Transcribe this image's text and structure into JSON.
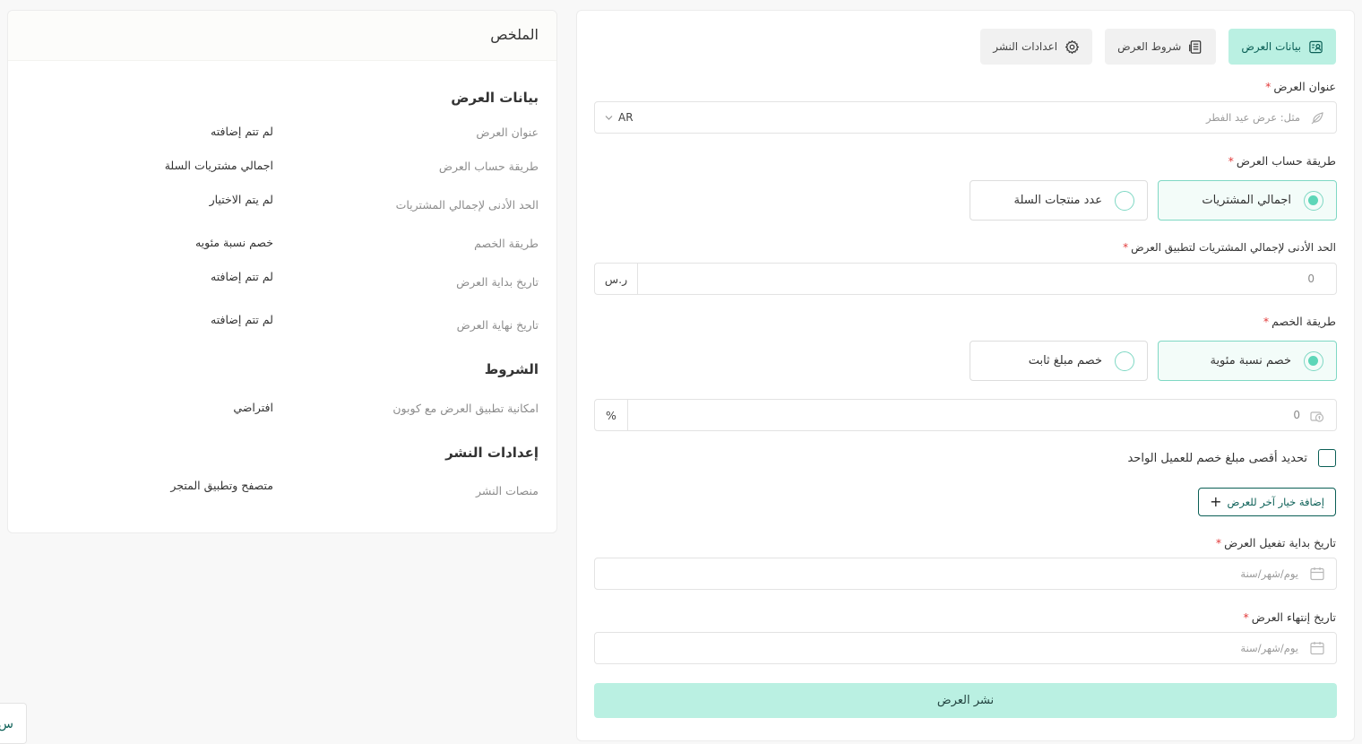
{
  "tabs": {
    "offer_data": "بيانات العرض",
    "offer_terms": "شروط العرض",
    "publish_settings": "اعدادات النشر"
  },
  "form": {
    "title_label": "عنوان العرض",
    "title_placeholder": "مثل: عرض عيد الفطر",
    "language": "AR",
    "calc_method_label": "طريقة حساب العرض",
    "calc_options": [
      "اجمالي المشتريات",
      "عدد منتجات السلة"
    ],
    "calc_selected": "اجمالي المشتريات",
    "min_total_label": "الحد الأدنى لإجمالي المشتريات لتطبيق العرض",
    "min_total_value": "0",
    "currency": "ر.س",
    "discount_method_label": "طريقة الخصم",
    "discount_options": [
      "خصم نسبة مئوية",
      "خصم مبلغ ثابت"
    ],
    "discount_selected": "خصم نسبة مئوية",
    "discount_value": "0",
    "percent_unit": "%",
    "max_discount_checkbox": "تحديد أقصى مبلغ خصم للعميل الواحد",
    "add_option_button": "إضافة خيار آخر للعرض",
    "start_date_label": "تاريخ بداية تفعيل العرض",
    "start_date_placeholder": "يوم/شهر/سنة",
    "end_date_label": "تاريخ إنتهاء العرض",
    "end_date_placeholder": "يوم/شهر/سنة",
    "publish_button": "نشر العرض",
    "required_mark": "*"
  },
  "summary": {
    "title": "الملخص",
    "sections": {
      "offer_data": {
        "title": "بيانات العرض",
        "rows": [
          {
            "key": "عنوان العرض",
            "value": "لم تتم إضافته"
          },
          {
            "key": "طريقة حساب العرض",
            "value": "اجمالي مشتريات السلة"
          },
          {
            "key": "الحد الأدنى لإجمالي المشتريات",
            "value": "لم يتم الاختيار"
          },
          {
            "key": "طريقة الخصم",
            "value": "خصم نسبة مئويه"
          },
          {
            "key": "تاريخ بداية العرض",
            "value": "لم تتم إضافته"
          },
          {
            "key": "تاريخ نهاية العرض",
            "value": "لم تتم إضافته"
          }
        ]
      },
      "terms": {
        "title": "الشروط",
        "rows": [
          {
            "key": "امكانية تطبيق العرض مع كوبون",
            "value": "افتراضي"
          }
        ]
      },
      "publish": {
        "title": "إعدادات النشر",
        "rows": [
          {
            "key": "منصات النشر",
            "value": "متصفح وتطبيق المتجر"
          }
        ]
      }
    }
  },
  "corner_widget_text": "س",
  "colors": {
    "accent": "#baf0e2",
    "accent_dark": "#0b5f56",
    "radio": "#5dd6b8",
    "required": "#e23b3b"
  }
}
